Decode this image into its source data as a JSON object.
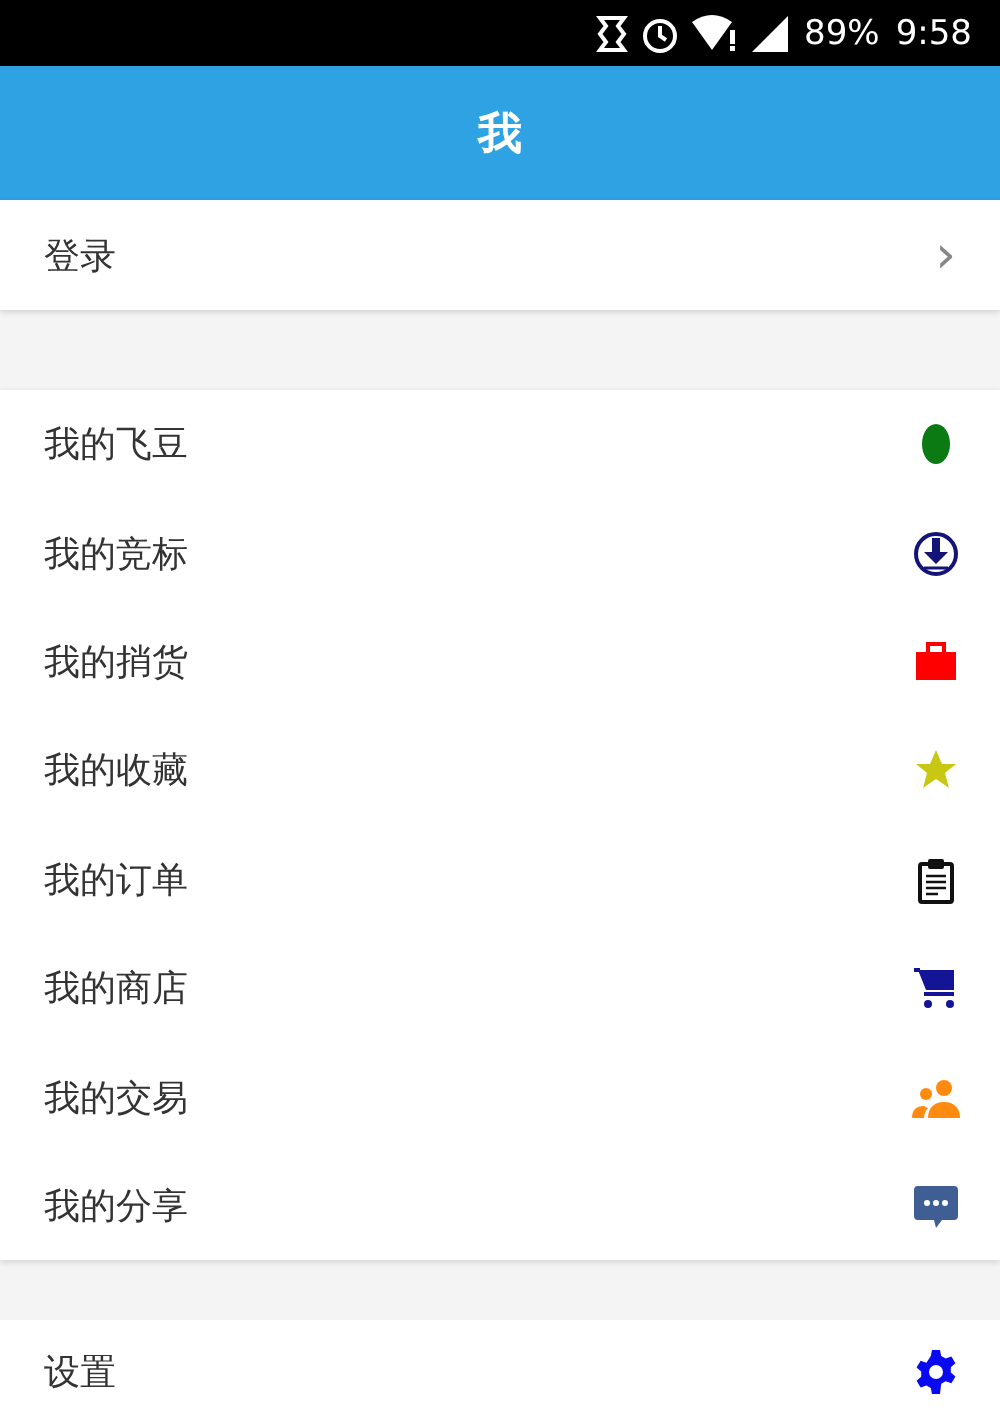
{
  "status_bar": {
    "battery": "89%",
    "time": "9:58"
  },
  "header": {
    "title": "我"
  },
  "login": {
    "label": "登录",
    "chevron": "›"
  },
  "menu": [
    {
      "label": "我的飞豆",
      "color": "#0b7a12"
    },
    {
      "label": "我的竞标",
      "color": "#141478"
    },
    {
      "label": "我的捎货",
      "color": "#ff0000"
    },
    {
      "label": "我的收藏",
      "color": "#c8c814"
    },
    {
      "label": "我的订单",
      "color": "#111111"
    },
    {
      "label": "我的商店",
      "color": "#141496"
    },
    {
      "label": "我的交易",
      "color": "#ff8a10"
    },
    {
      "label": "我的分享",
      "color": "#3f5f94"
    }
  ],
  "settings": {
    "label": "设置",
    "color": "#0a0af0"
  }
}
